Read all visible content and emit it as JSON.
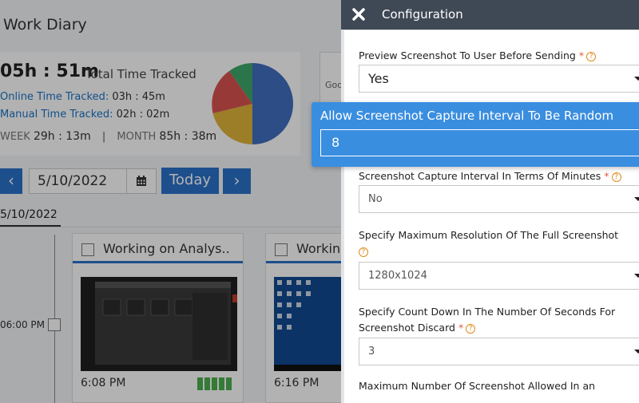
{
  "app": {
    "title": "Work Diary",
    "summary": {
      "total_hours": "05h : 51m",
      "total_label": "Total Time Tracked",
      "online_label": "Online Time Tracked:",
      "online_value": "03h : 45m",
      "manual_label": "Manual Time Tracked:",
      "manual_value": "02h : 02m",
      "week_label": "WEEK",
      "week_value": "29h : 13m",
      "separator": "|",
      "month_label": "MONTH",
      "month_value": "85h : 38m"
    },
    "right_card_text": "Goo",
    "date_nav": {
      "prev_symbol": "‹",
      "date_value": "5/10/2022",
      "today_label": "Today",
      "next_symbol": "›"
    },
    "date_tab": "5/10/2022",
    "timeline": {
      "time_label": "06:00 PM"
    },
    "cards": [
      {
        "title": "Working on Analys..",
        "time": "6:08 PM",
        "activity_level": "5 of 5"
      },
      {
        "title": "Workin",
        "time": "6:16 PM"
      }
    ],
    "pie_colors": [
      "#3f6fbf",
      "#e0b43a",
      "#d9534f",
      "#3fa66a"
    ]
  },
  "drawer": {
    "title": "Configuration",
    "fields": [
      {
        "label": "Preview Screenshot To User Before Sending",
        "required": "*",
        "value": "Yes"
      },
      {
        "label": "Screenshot Capture Interval In Terms Of Minutes",
        "required": "*",
        "value": "No"
      },
      {
        "label_line1": "Specify Maximum Resolution Of The Full Screenshot",
        "value": "1280x1024"
      },
      {
        "label_line1": "Specify Count Down In The Number Of Seconds For",
        "label_line2": "Screenshot Discard",
        "required": "*",
        "value": "3"
      },
      {
        "label": "Maximum Number Of Screenshot Allowed In an"
      }
    ]
  },
  "tooltip": {
    "title": "Allow Screenshot Capture Interval To Be Random",
    "input_value": "8"
  },
  "colors": {
    "primary_blue": "#2a72c9",
    "tooltip_blue": "#3a8ee0",
    "drawer_header": "#3f4855",
    "required_red": "#e05a3a",
    "help_orange": "#e08a1e"
  }
}
